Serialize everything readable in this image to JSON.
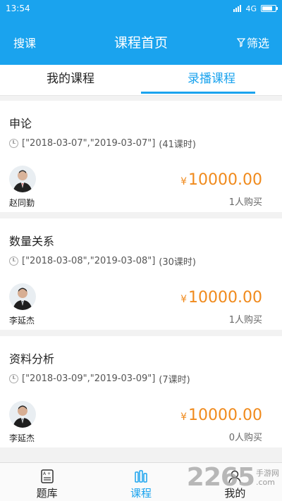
{
  "status_bar": {
    "time": "13:54",
    "network": "4G",
    "battery_level": 0.8
  },
  "header": {
    "search_label": "搜课",
    "title": "课程首页",
    "filter_label": "筛选"
  },
  "tabs": [
    {
      "label": "我的课程",
      "active": false
    },
    {
      "label": "录播课程",
      "active": true
    }
  ],
  "courses": [
    {
      "name": "申论",
      "dates": "[\"2018-03-07\",\"2019-03-07\"]",
      "lessons": "(41课时)",
      "teacher": "赵同勤",
      "currency": "¥",
      "price": "10000.00",
      "buyers": "1人购买"
    },
    {
      "name": "数量关系",
      "dates": "[\"2018-03-08\",\"2019-03-08\"]",
      "lessons": "(30课时)",
      "teacher": "李延杰",
      "currency": "¥",
      "price": "10000.00",
      "buyers": "1人购买"
    },
    {
      "name": "资料分析",
      "dates": "[\"2018-03-09\",\"2019-03-09\"]",
      "lessons": "(7课时)",
      "teacher": "李延杰",
      "currency": "¥",
      "price": "10000.00",
      "buyers": "0人购买"
    }
  ],
  "bottom_nav": [
    {
      "label": "题库",
      "icon": "question-bank-icon",
      "active": false
    },
    {
      "label": "课程",
      "icon": "course-icon",
      "active": true
    },
    {
      "label": "我的",
      "icon": "profile-icon",
      "active": false
    }
  ],
  "watermark": {
    "number": "2265",
    "line1": "手游网",
    "line2": ".com"
  },
  "colors": {
    "primary": "#1aa3ee",
    "price": "#f08a1c"
  }
}
